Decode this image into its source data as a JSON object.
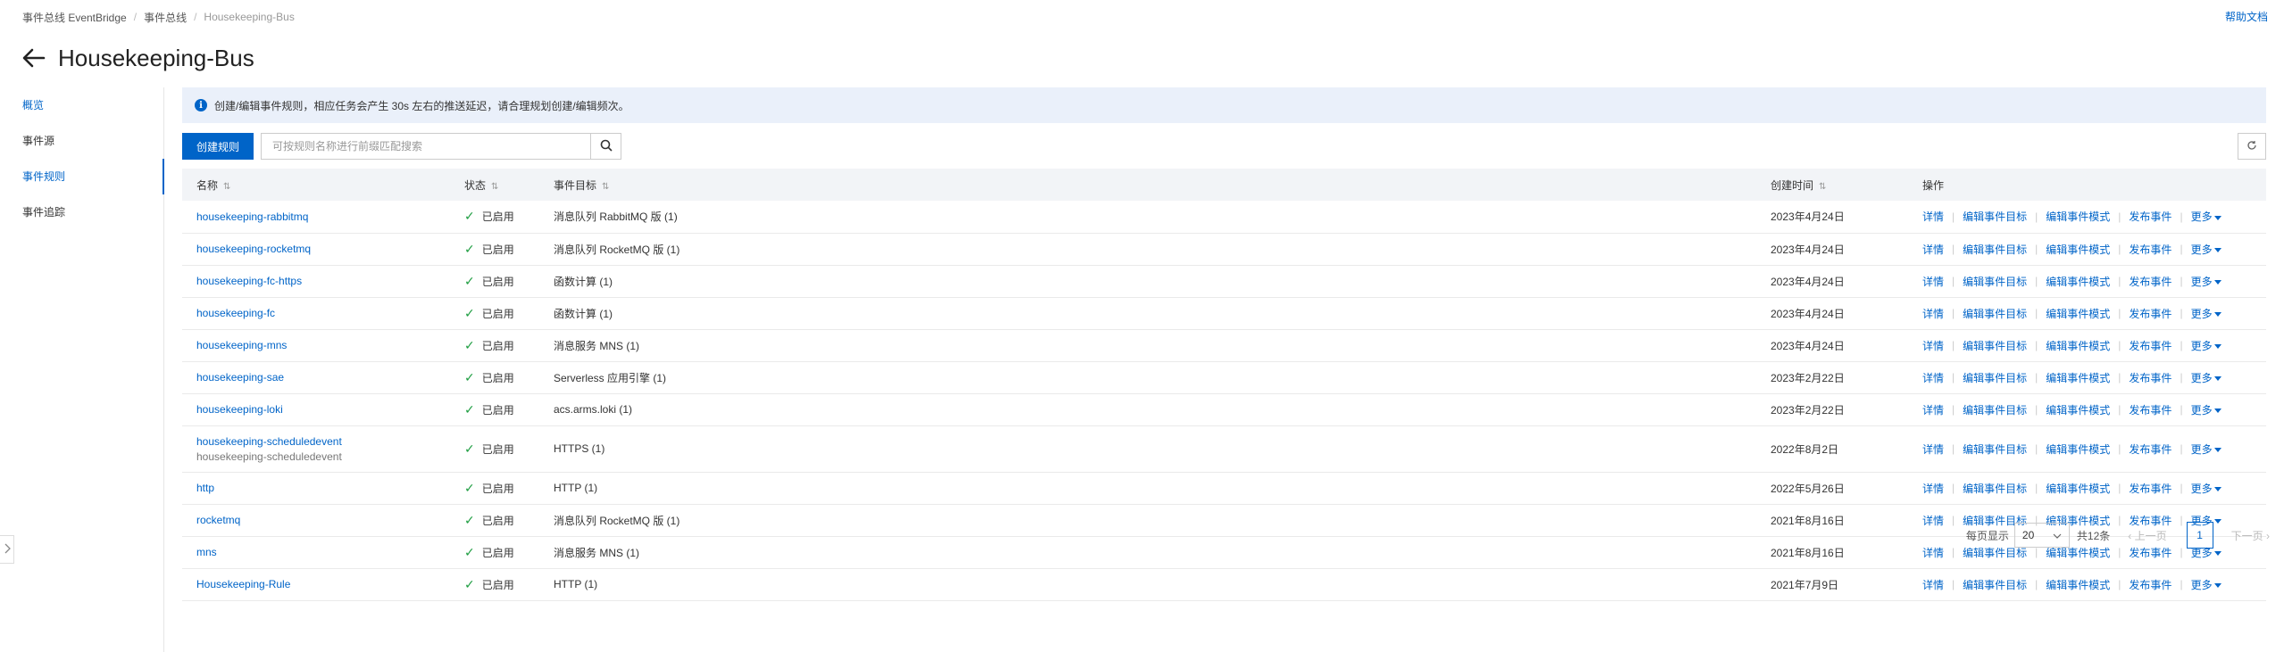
{
  "breadcrumb": [
    "事件总线 EventBridge",
    "事件总线",
    "Housekeeping-Bus"
  ],
  "help_link": "帮助文档",
  "page_title": "Housekeeping-Bus",
  "sidenav": [
    "概览",
    "事件源",
    "事件规则",
    "事件追踪"
  ],
  "notice": "创建/编辑事件规则，相应任务会产生 30s 左右的推送延迟，请合理规划创建/编辑频次。",
  "toolbar": {
    "create_label": "创建规则",
    "search_placeholder": "可按规则名称进行前缀匹配搜索"
  },
  "table": {
    "headers": [
      "名称",
      "状态",
      "事件目标",
      "创建时间",
      "操作"
    ],
    "ops": [
      "详情",
      "编辑事件目标",
      "编辑事件模式",
      "发布事件",
      "更多"
    ],
    "rows": [
      {
        "name": "housekeeping-rabbitmq",
        "status": "已启用",
        "target": "消息队列 RabbitMQ 版 (1)",
        "created": "2023年4月24日"
      },
      {
        "name": "housekeeping-rocketmq",
        "status": "已启用",
        "target": "消息队列 RocketMQ 版 (1)",
        "created": "2023年4月24日"
      },
      {
        "name": "housekeeping-fc-https",
        "status": "已启用",
        "target": "函数计算 (1)",
        "created": "2023年4月24日"
      },
      {
        "name": "housekeeping-fc",
        "status": "已启用",
        "target": "函数计算 (1)",
        "created": "2023年4月24日"
      },
      {
        "name": "housekeeping-mns",
        "status": "已启用",
        "target": "消息服务 MNS (1)",
        "created": "2023年4月24日"
      },
      {
        "name": "housekeeping-sae",
        "status": "已启用",
        "target": "Serverless 应用引擎 (1)",
        "created": "2023年2月22日"
      },
      {
        "name": "housekeeping-loki",
        "status": "已启用",
        "target": "acs.arms.loki (1)",
        "created": "2023年2月22日"
      },
      {
        "name": "housekeeping-scheduledevent",
        "subname": "housekeeping-scheduledevent",
        "status": "已启用",
        "target": "HTTPS (1)",
        "created": "2022年8月2日"
      },
      {
        "name": "http",
        "status": "已启用",
        "target": "HTTP (1)",
        "created": "2022年5月26日"
      },
      {
        "name": "rocketmq",
        "status": "已启用",
        "target": "消息队列 RocketMQ 版 (1)",
        "created": "2021年8月16日"
      },
      {
        "name": "mns",
        "status": "已启用",
        "target": "消息服务 MNS (1)",
        "created": "2021年8月16日"
      },
      {
        "name": "Housekeeping-Rule",
        "status": "已启用",
        "target": "HTTP (1)",
        "created": "2021年7月9日"
      }
    ]
  },
  "pagination": {
    "per_page_label": "每页显示",
    "per_page_value": "20",
    "total": "共12条",
    "prev": "上一页",
    "current": "1",
    "next": "下一页"
  },
  "colors": {
    "accent": "#0064c8",
    "success": "#1e9d41",
    "notice_bg": "#eaf0fa"
  },
  "icons": [
    "back-arrow-icon",
    "info-icon",
    "search-icon",
    "refresh-icon",
    "check-icon",
    "chevron-down-icon",
    "chevron-left-icon",
    "chevron-right-icon",
    "sort-icon"
  ]
}
